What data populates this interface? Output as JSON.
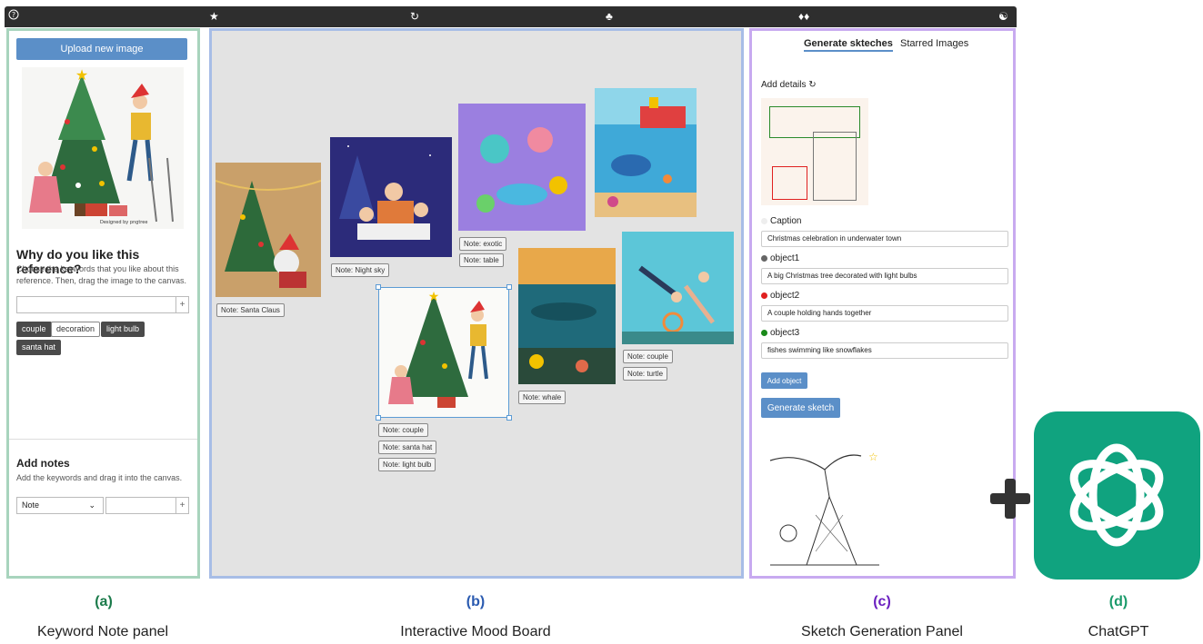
{
  "topbar": {
    "icons": [
      "help-circle-icon",
      "star-icon",
      "refresh-icon",
      "tree-icon",
      "drops-icon",
      "pair-icon"
    ]
  },
  "panel_a": {
    "upload_label": "Upload new image",
    "why_title": "Why do you like this reference?",
    "why_desc": "Choose the keywords that you like about this reference. Then, drag the image to the canvas.",
    "plus": "+",
    "keywords": [
      {
        "label": "couple",
        "style": "dark"
      },
      {
        "label": "decoration",
        "style": "light"
      },
      {
        "label": "light bulb",
        "style": "dark"
      },
      {
        "label": "santa hat",
        "style": "dark"
      }
    ],
    "notes_title": "Add notes",
    "notes_desc": "Add the keywords and drag it into the canvas.",
    "select_value": "Note"
  },
  "moodboard": {
    "notes": [
      "Note: Santa Claus",
      "Note: Night sky",
      "Note: exotic",
      "Note: table",
      "Note: couple",
      "Note: santa hat",
      "Note: light bulb",
      "Note: whale",
      "Note: couple",
      "Note: turtle"
    ]
  },
  "panel_c": {
    "tabs": [
      "Generate skteches",
      "Starred Images"
    ],
    "add_details": "Add details",
    "caption_label": "Caption",
    "caption_value": "Christmas celebration in underwater town",
    "objects": [
      {
        "label": "object1",
        "color": "#666666",
        "value": "A big Christmas tree decorated with light bulbs"
      },
      {
        "label": "object2",
        "color": "#e02020",
        "value": "A couple holding hands together"
      },
      {
        "label": "object3",
        "color": "#1a8a1a",
        "value": "fishes swimming like snowflakes"
      }
    ],
    "add_object": "Add object",
    "generate": "Generate sketch"
  },
  "captions": [
    {
      "letter": "(a)",
      "text": "Keyword Note panel",
      "color": "#1a7a4a"
    },
    {
      "letter": "(b)",
      "text": "Interactive Mood Board",
      "color": "#2a5ab0"
    },
    {
      "letter": "(c)",
      "text": "Sketch Generation Panel",
      "color": "#6a1fc0"
    },
    {
      "letter": "(d)",
      "text": "ChatGPT",
      "color": "#1a9a6a"
    }
  ],
  "colors": {
    "chatgpt_green": "#10a37f",
    "accent_blue": "#5b8fc8"
  }
}
